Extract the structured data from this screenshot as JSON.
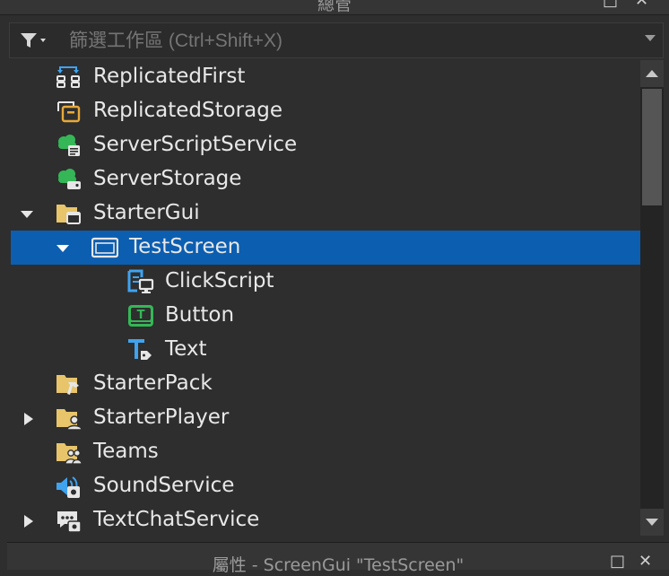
{
  "top_panel": {
    "title": "總管",
    "ctrl_float": "□",
    "ctrl_close": "✕"
  },
  "filter": {
    "placeholder": "篩選工作區 (Ctrl+Shift+X)"
  },
  "tree": [
    {
      "label": "ReplicatedFirst",
      "icon": "replicated-first-icon",
      "expander": "none"
    },
    {
      "label": "ReplicatedStorage",
      "icon": "replicated-storage-icon",
      "expander": "none"
    },
    {
      "label": "ServerScriptService",
      "icon": "server-script-service-icon",
      "expander": "none"
    },
    {
      "label": "ServerStorage",
      "icon": "server-storage-icon",
      "expander": "none"
    },
    {
      "label": "StarterGui",
      "icon": "starter-gui-icon",
      "expander": "expanded"
    },
    {
      "label": "TestScreen",
      "icon": "screen-gui-icon",
      "expander": "expanded",
      "selected": true
    },
    {
      "label": "ClickScript",
      "icon": "local-script-icon",
      "expander": "none"
    },
    {
      "label": "Button",
      "icon": "text-button-icon",
      "expander": "none"
    },
    {
      "label": "Text",
      "icon": "text-label-icon",
      "expander": "none"
    },
    {
      "label": "StarterPack",
      "icon": "starter-pack-icon",
      "expander": "none"
    },
    {
      "label": "StarterPlayer",
      "icon": "starter-player-icon",
      "expander": "collapsed"
    },
    {
      "label": "Teams",
      "icon": "teams-icon",
      "expander": "none"
    },
    {
      "label": "SoundService",
      "icon": "sound-service-icon",
      "expander": "none"
    },
    {
      "label": "TextChatService",
      "icon": "text-chat-service-icon",
      "expander": "collapsed"
    }
  ],
  "bottom_panel": {
    "title": "屬性 - ScreenGui \"TestScreen\"",
    "ctrl_float": "□",
    "ctrl_close": "✕"
  },
  "colors": {
    "selection": "#0c5eb0",
    "folder": "#e8c46a",
    "accent_blue": "#3fa3f0",
    "accent_green": "#35b757"
  }
}
